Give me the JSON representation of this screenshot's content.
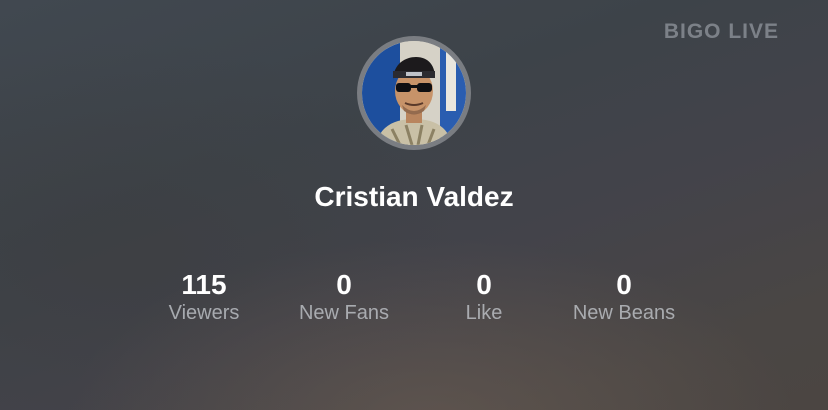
{
  "watermark": "BIGO LIVE",
  "broadcaster": {
    "name": "Cristian Valdez"
  },
  "stats": [
    {
      "value": "115",
      "label": "Viewers"
    },
    {
      "value": "0",
      "label": "New Fans"
    },
    {
      "value": "0",
      "label": "Like"
    },
    {
      "value": "0",
      "label": "New Beans"
    }
  ],
  "colors": {
    "text_primary": "#ffffff",
    "text_secondary": "#c8ccd2",
    "avatar_ring": "#7a7d82"
  }
}
